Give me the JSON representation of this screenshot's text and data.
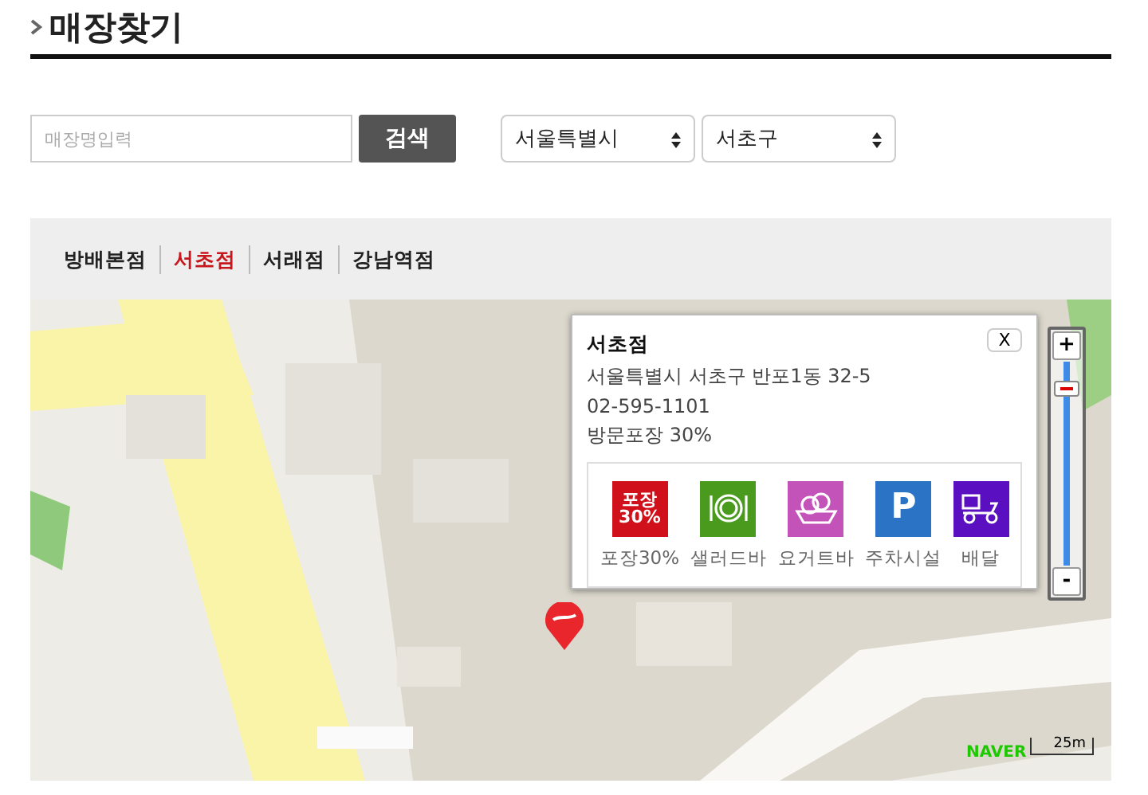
{
  "page_title": "매장찾기",
  "search": {
    "placeholder": "매장명입력",
    "button": "검색"
  },
  "selects": [
    {
      "value": "서울특별시"
    },
    {
      "value": "서초구"
    }
  ],
  "store_tabs": [
    {
      "label": "방배본점",
      "selected": false
    },
    {
      "label": "서초점",
      "selected": true
    },
    {
      "label": "서래점",
      "selected": false
    },
    {
      "label": "강남역점",
      "selected": false
    }
  ],
  "map": {
    "kind": "picture",
    "logo": "NAVER",
    "scale": "25m",
    "zoom_in": "+",
    "zoom_out": "-",
    "level": 0.87
  },
  "popup": {
    "name": "서초점",
    "address": "서울특별시 서초구 반포1동 32-5",
    "phone": "02-595-1101",
    "note": "방문포장 30%",
    "close": "X",
    "services": [
      {
        "kind": "takeout",
        "label": "포장30%",
        "badge_lines": [
          "포장",
          "30%"
        ],
        "color": "#d0101a"
      },
      {
        "kind": "salad",
        "label": "샐러드바",
        "color": "#4a9a1e"
      },
      {
        "kind": "yogurt",
        "label": "요거트바",
        "color": "#c353b8"
      },
      {
        "kind": "parking",
        "label": "주차시설",
        "badge_lines": [
          "P"
        ],
        "color": "#2b73c4"
      },
      {
        "kind": "delivery",
        "label": "배달",
        "color": "#5a0fc0"
      }
    ]
  }
}
